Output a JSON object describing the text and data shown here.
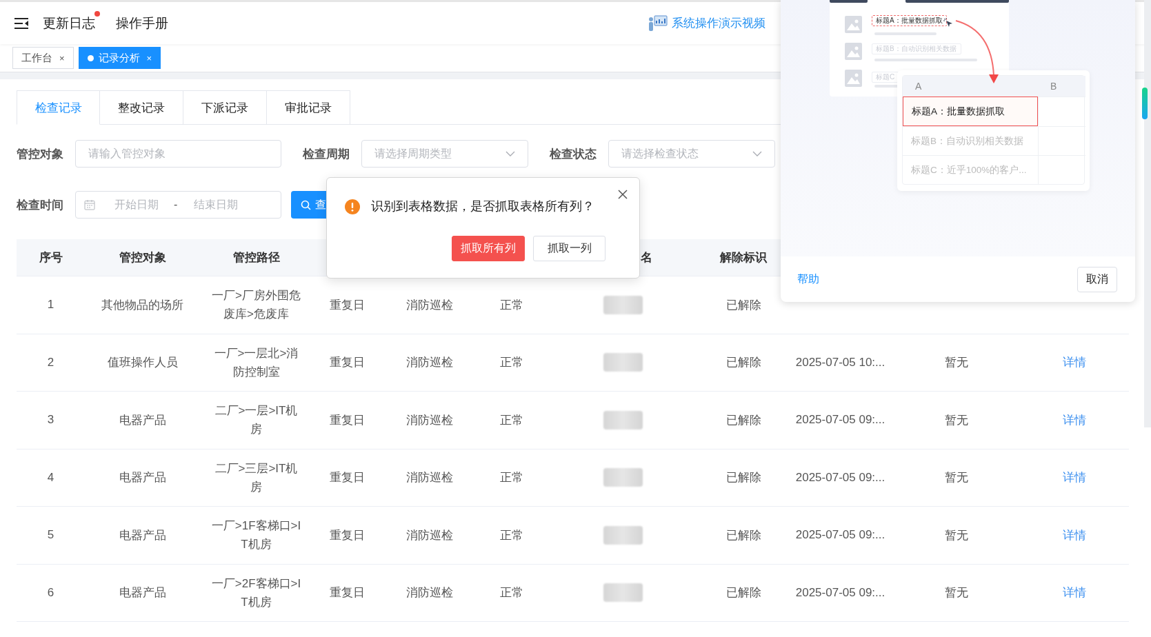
{
  "header": {
    "nav": [
      {
        "label": "更新日志",
        "badge": true
      },
      {
        "label": "操作手册",
        "badge": false
      }
    ],
    "video_link": "系统操作演示视频"
  },
  "tags": [
    {
      "label": "工作台",
      "close": "×",
      "selected": false
    },
    {
      "label": "记录分析",
      "close": "×",
      "selected": true
    }
  ],
  "tabs": [
    {
      "label": "检查记录",
      "selected": true
    },
    {
      "label": "整改记录",
      "selected": false
    },
    {
      "label": "下派记录",
      "selected": false
    },
    {
      "label": "审批记录",
      "selected": false
    }
  ],
  "filters": [
    {
      "label": "管控对象",
      "kind": "input",
      "placeholder": "请输入管控对象"
    },
    {
      "label": "检查周期",
      "kind": "select",
      "placeholder": "请选择周期类型"
    },
    {
      "label": "检查状态",
      "kind": "select",
      "placeholder": "请选择检查状态"
    }
  ],
  "date_filter": {
    "label": "检查时间",
    "start_placeholder": "开始日期",
    "separator": "-",
    "end_placeholder": "结束日期"
  },
  "search_button": "查",
  "table": {
    "columns": {
      "column_1": "序号",
      "column_2": "管控对象",
      "column_3": "管控路径",
      "column_7": "名",
      "column_8": "解除标识"
    },
    "rows": [
      {
        "cells": [
          "1",
          "其他物品的场所",
          "一厂>厂房外围危废库>危废库",
          "重复日",
          "消防巡检",
          "正常",
          "已解除"
        ]
      },
      {
        "cells": [
          "2",
          "值班操作人员",
          "一厂>一层北>消防控制室",
          "重复日",
          "消防巡检",
          "正常",
          "已解除",
          "2025-07-05 10:...",
          "暂无"
        ],
        "action": "详情"
      },
      {
        "cells": [
          "3",
          "电器产品",
          "二厂>一层>IT机房",
          "重复日",
          "消防巡检",
          "正常",
          "已解除",
          "2025-07-05 09:...",
          "暂无"
        ],
        "action": "详情"
      },
      {
        "cells": [
          "4",
          "电器产品",
          "二厂>三层>IT机房",
          "重复日",
          "消防巡检",
          "正常",
          "已解除",
          "2025-07-05 09:...",
          "暂无"
        ],
        "action": "详情"
      },
      {
        "cells": [
          "5",
          "电器产品",
          "一厂>1F客梯口>IT机房",
          "重复日",
          "消防巡检",
          "正常",
          "已解除",
          "2025-07-05 09:...",
          "暂无"
        ],
        "action": "详情"
      },
      {
        "cells": [
          "6",
          "电器产品",
          "一厂>2F客梯口>IT机房",
          "重复日",
          "消防巡检",
          "正常",
          "已解除",
          "2025-07-05 09:...",
          "暂无"
        ],
        "action": "详情"
      }
    ]
  },
  "dialog": {
    "message": "识别到表格数据，是否抓取表格所有列？",
    "buttons": [
      {
        "label": "抓取所有列",
        "kind": "primary"
      },
      {
        "label": "抓取一列",
        "kind": "default"
      }
    ]
  },
  "panel": {
    "source_items": [
      {
        "label": "标题A：批量数据抓取",
        "selected": true
      },
      {
        "label": "标题B：自动识别相关数据",
        "selected": false
      },
      {
        "label": "标题C",
        "selected": false
      }
    ],
    "sheet": {
      "columns": [
        "A",
        "B"
      ],
      "rows": [
        {
          "label": "标题A：批量数据抓取",
          "selected": true
        },
        {
          "label": "标题B：自动识别相关数据",
          "selected": false
        },
        {
          "label": "标题C：近乎100%的客户...",
          "selected": false
        }
      ]
    },
    "help_link": "帮助",
    "cancel_button": "取消"
  }
}
